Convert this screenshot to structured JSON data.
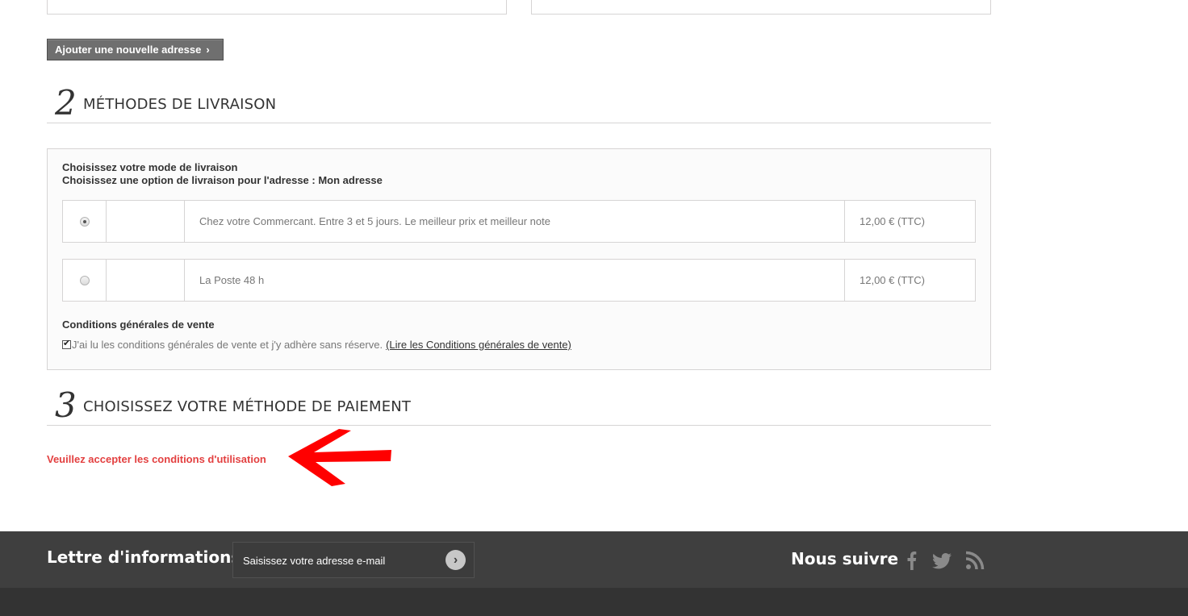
{
  "addresses": {
    "add_button_label": "Ajouter une nouvelle adresse"
  },
  "step2": {
    "number": "2",
    "title": "MÉTHODES DE LIVRAISON",
    "heading": "Choisissez votre mode de livraison",
    "subheading": "Choisissez une option de livraison pour l'adresse : Mon adresse",
    "carriers": [
      {
        "description": "Chez votre Commercant. Entre 3 et 5 jours. Le meilleur prix et meilleur note",
        "price": "12,00 € (TTC)",
        "selected": true
      },
      {
        "description": "La Poste 48 h",
        "price": "12,00 € (TTC)",
        "selected": false
      }
    ],
    "terms_title": "Conditions générales de vente",
    "terms_text": "J'ai lu les conditions générales de vente et j'y adhère sans réserve.",
    "terms_link": "(Lire les Conditions générales de vente)",
    "terms_checked": true
  },
  "step3": {
    "number": "3",
    "title": "CHOISISSEZ VOTRE MÉTHODE DE PAIEMENT",
    "warning": "Veuillez accepter les conditions d'utilisation"
  },
  "footer": {
    "newsletter_title": "Lettre d'informations",
    "newsletter_placeholder": "Saisissez votre adresse e-mail",
    "follow_title": "Nous suivre",
    "social_icons": [
      "facebook-icon",
      "twitter-icon",
      "rss-icon"
    ]
  },
  "colors": {
    "warning": "#e34040",
    "annotation_arrow": "#ff0000",
    "footer_bg": "#3f3f3f",
    "footer_bottom_bg": "#333333",
    "button_bg": "#6f6f6f"
  }
}
